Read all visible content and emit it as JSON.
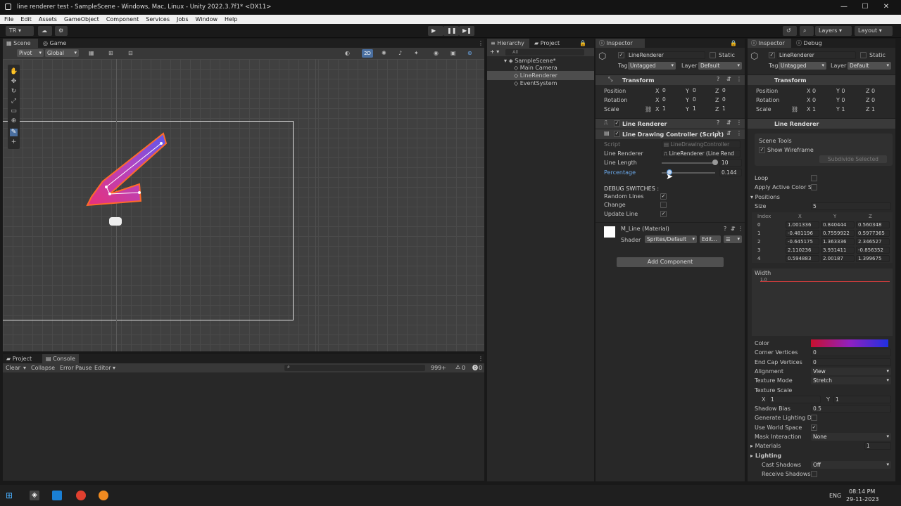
{
  "window": {
    "title": "line renderer test - SampleScene - Windows, Mac, Linux - Unity 2022.3.7f1* <DX11>",
    "min": "—",
    "max": "☐",
    "close": "✕"
  },
  "menu": [
    "File",
    "Edit",
    "Assets",
    "GameObject",
    "Component",
    "Services",
    "Jobs",
    "Window",
    "Help"
  ],
  "toolbar": {
    "account": "TR",
    "layers": "Layers",
    "layout": "Layout"
  },
  "scene": {
    "tab_scene": "Scene",
    "tab_game": "Game",
    "pivot": "Pivot",
    "global": "Global",
    "mode2d": "2D"
  },
  "hierarchy": {
    "tab": "Hierarchy",
    "tab_project": "Project",
    "search": "All",
    "scene": "SampleScene*",
    "items": [
      "Main Camera",
      "LineRenderer",
      "EventSystem"
    ]
  },
  "inspector1": {
    "tab": "Inspector",
    "name": "LineRenderer",
    "static": "Static",
    "tag_label": "Tag",
    "tag": "Untagged",
    "layer_label": "Layer",
    "layer": "Default",
    "transform": "Transform",
    "position": "Position",
    "rotation": "Rotation",
    "scale": "Scale",
    "pos": [
      "0",
      "0",
      "0"
    ],
    "rot": [
      "0",
      "0",
      "0"
    ],
    "scl": [
      "1",
      "1",
      "1"
    ],
    "line_renderer": "Line Renderer",
    "ldc": "Line Drawing Controller (Script)",
    "script_label": "Script",
    "script_value": "LineDrawingController",
    "lr_label": "Line Renderer",
    "lr_value": "LineRenderer (Line Rend",
    "length_label": "Line Length",
    "length_value": "10",
    "percent_label": "Percentage",
    "percent_value": "0.144",
    "percent_fraction": 0.144,
    "debug": "DEBUG SWITCHES :",
    "random": "Random Lines",
    "change": "Change",
    "update": "Update Line",
    "material": "M_Line (Material)",
    "shader_label": "Shader",
    "shader": "Sprites/Default",
    "edit": "Edit...",
    "add_component": "Add Component"
  },
  "inspector2": {
    "tab": "Inspector",
    "debug_tab": "Debug",
    "name": "LineRenderer",
    "static": "Static",
    "tag_label": "Tag",
    "tag": "Untagged",
    "layer_label": "Layer",
    "layer": "Default",
    "transform": "Transform",
    "line_renderer": "Line Renderer",
    "scene_tools": "Scene Tools",
    "show_wire": "Show Wireframe",
    "subdivide": "Subdivide Selected",
    "loop": "Loop",
    "apply_color": "Apply Active Color Sp",
    "positions": "Positions",
    "size_label": "Size",
    "size": "5",
    "cols": [
      "Index",
      "X",
      "Y",
      "Z"
    ],
    "rows": [
      [
        "0",
        "1.001336",
        "0.840444",
        "0.560348"
      ],
      [
        "1",
        "-0.481196",
        "0.7559922",
        "0.5977365"
      ],
      [
        "2",
        "-0.645175",
        "1.363336",
        "2.346527"
      ],
      [
        "3",
        "2.110236",
        "3.931411",
        "-0.856352"
      ],
      [
        "4",
        "0.594883",
        "2.00187",
        "1.399675"
      ]
    ],
    "width": "Width",
    "width_value": "1.0",
    "color": "Color",
    "corner": "Corner Vertices",
    "corner_v": "0",
    "endcap": "End Cap Vertices",
    "endcap_v": "0",
    "alignment": "Alignment",
    "alignment_v": "View",
    "texmode": "Texture Mode",
    "texmode_v": "Stretch",
    "texscale": "Texture Scale",
    "ts_x": "1",
    "ts_y": "1",
    "shadowbias": "Shadow Bias",
    "shadowbias_v": "0.5",
    "genlight": "Generate Lighting Da",
    "worldspace": "Use World Space",
    "mask": "Mask Interaction",
    "mask_v": "None",
    "materials": "Materials",
    "materials_v": "1",
    "lighting": "Lighting",
    "cast": "Cast Shadows",
    "cast_v": "Off",
    "receive": "Receive Shadows"
  },
  "console": {
    "tab_project": "Project",
    "tab_console": "Console",
    "clear": "Clear",
    "collapse": "Collapse",
    "error_pause": "Error Pause",
    "editor": "Editor",
    "count_log": "999+",
    "count_warn": "0",
    "count_err": "0"
  },
  "taskbar": {
    "lang": "ENG",
    "time": "08:14 PM",
    "date": "29-11-2023"
  },
  "colors": {
    "accent": "#4a8fd6",
    "line_start": "#c8102e",
    "line_end": "#2030e0"
  }
}
